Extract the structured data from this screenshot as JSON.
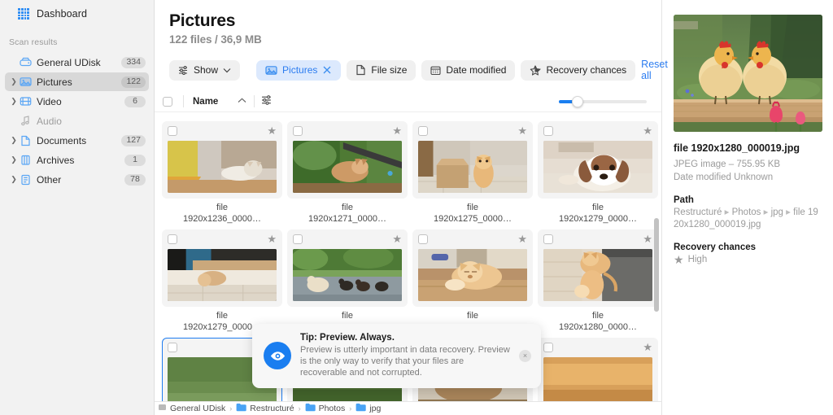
{
  "sidebar": {
    "dashboard_label": "Dashboard",
    "scan_results_label": "Scan results",
    "items": [
      {
        "label": "General UDisk",
        "badge": "334",
        "icon": "disk-icon",
        "chevron": false,
        "active": false,
        "dim": false
      },
      {
        "label": "Pictures",
        "badge": "122",
        "icon": "pictures-icon",
        "chevron": true,
        "active": true,
        "dim": false
      },
      {
        "label": "Video",
        "badge": "6",
        "icon": "video-icon",
        "chevron": true,
        "active": false,
        "dim": false
      },
      {
        "label": "Audio",
        "badge": "",
        "icon": "audio-icon",
        "chevron": false,
        "active": false,
        "dim": true
      },
      {
        "label": "Documents",
        "badge": "127",
        "icon": "document-icon",
        "chevron": true,
        "active": false,
        "dim": false
      },
      {
        "label": "Archives",
        "badge": "1",
        "icon": "archive-icon",
        "chevron": true,
        "active": false,
        "dim": false
      },
      {
        "label": "Other",
        "badge": "78",
        "icon": "other-icon",
        "chevron": true,
        "active": false,
        "dim": false
      }
    ]
  },
  "header": {
    "title": "Pictures",
    "subtitle": "122 files / 36,9 MB"
  },
  "filters": {
    "show_label": "Show",
    "chips": [
      {
        "label": "Pictures",
        "icon": "pictures-icon",
        "active": true,
        "closable": true
      },
      {
        "label": "File size",
        "icon": "document-icon",
        "active": false,
        "closable": false
      },
      {
        "label": "Date modified",
        "icon": "calendar-icon",
        "active": false,
        "closable": false
      },
      {
        "label": "Recovery chances",
        "icon": "star-icon",
        "active": false,
        "closable": false
      }
    ],
    "reset_label": "Reset all"
  },
  "table": {
    "name_column": "Name",
    "sort_direction": "ascending",
    "zoom_percent": 15
  },
  "grid": {
    "items": [
      {
        "caption_line1": "file",
        "caption_line2": "1920x1236_0000…",
        "image": "cat-in-bag",
        "selected": false,
        "starred": true
      },
      {
        "caption_line1": "file",
        "caption_line2": "1920x1271_0000…",
        "image": "rabbit-outdoor",
        "selected": false,
        "starred": true
      },
      {
        "caption_line1": "file",
        "caption_line2": "1920x1275_0000…",
        "image": "cat-box",
        "selected": false,
        "starred": true
      },
      {
        "caption_line1": "file",
        "caption_line2": "1920x1279_0000…",
        "image": "dog-floor",
        "selected": false,
        "starred": true
      },
      {
        "caption_line1": "file",
        "caption_line2": "1920x1279_0000…",
        "image": "cat-couch",
        "selected": false,
        "starred": true
      },
      {
        "caption_line1": "file",
        "caption_line2": "",
        "image": "chickens-road",
        "selected": false,
        "starred": true
      },
      {
        "caption_line1": "file",
        "caption_line2": "",
        "image": "cat-sleeping",
        "selected": false,
        "starred": true
      },
      {
        "caption_line1": "file",
        "caption_line2": "1920x1280_0000…",
        "image": "cat-chair",
        "selected": false,
        "starred": true
      },
      {
        "caption_line1": "",
        "caption_line2": "",
        "image": "grass-strip",
        "selected": true,
        "starred": true
      },
      {
        "caption_line1": "",
        "caption_line2": "",
        "image": "green-strip",
        "selected": false,
        "starred": true
      },
      {
        "caption_line1": "",
        "caption_line2": "",
        "image": "tabby-strip",
        "selected": false,
        "starred": true
      },
      {
        "caption_line1": "",
        "caption_line2": "",
        "image": "orange-strip",
        "selected": false,
        "starred": true
      }
    ]
  },
  "toast": {
    "title": "Tip: Preview. Always.",
    "text": "Preview is utterly important in data recovery. Preview is the only way to verify that your files are recoverable and not corrupted.",
    "icon": "eye-icon",
    "close_label": "×"
  },
  "breadcrumb": {
    "items": [
      "General UDisk",
      "Restructuré",
      "Photos",
      "jpg"
    ],
    "separator": "›"
  },
  "details": {
    "preview_image": "two-chickens-tulips",
    "file_name": "file 1920x1280_000019.jpg",
    "file_type_size": "JPEG image – 755.95 KB",
    "date_modified": "Date modified Unknown",
    "path_label": "Path",
    "path_parts": [
      "Restructuré",
      "Photos",
      "jpg",
      "file 1920x1280_000019.jpg"
    ],
    "path_separator": "▸",
    "recovery_label": "Recovery chances",
    "recovery_value": "High",
    "recovery_icon": "star-icon"
  },
  "colors": {
    "accent": "#2b7cf0",
    "chip_active_bg": "#dce9fd",
    "sidebar_bg": "#f2f2f2",
    "selection_border": "#1f7df0"
  }
}
